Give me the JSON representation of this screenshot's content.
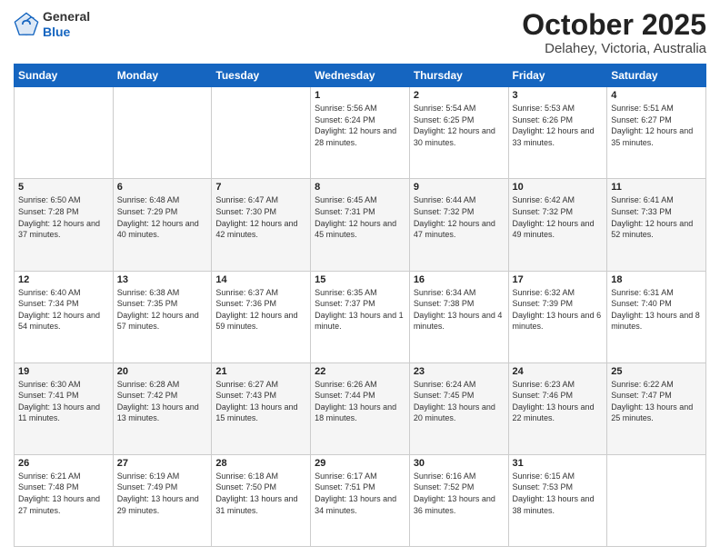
{
  "header": {
    "logo_line1": "General",
    "logo_line2": "Blue",
    "title": "October 2025",
    "subtitle": "Delahey, Victoria, Australia"
  },
  "days_of_week": [
    "Sunday",
    "Monday",
    "Tuesday",
    "Wednesday",
    "Thursday",
    "Friday",
    "Saturday"
  ],
  "weeks": [
    [
      {
        "num": "",
        "sunrise": "",
        "sunset": "",
        "daylight": ""
      },
      {
        "num": "",
        "sunrise": "",
        "sunset": "",
        "daylight": ""
      },
      {
        "num": "",
        "sunrise": "",
        "sunset": "",
        "daylight": ""
      },
      {
        "num": "1",
        "sunrise": "Sunrise: 5:56 AM",
        "sunset": "Sunset: 6:24 PM",
        "daylight": "Daylight: 12 hours and 28 minutes."
      },
      {
        "num": "2",
        "sunrise": "Sunrise: 5:54 AM",
        "sunset": "Sunset: 6:25 PM",
        "daylight": "Daylight: 12 hours and 30 minutes."
      },
      {
        "num": "3",
        "sunrise": "Sunrise: 5:53 AM",
        "sunset": "Sunset: 6:26 PM",
        "daylight": "Daylight: 12 hours and 33 minutes."
      },
      {
        "num": "4",
        "sunrise": "Sunrise: 5:51 AM",
        "sunset": "Sunset: 6:27 PM",
        "daylight": "Daylight: 12 hours and 35 minutes."
      }
    ],
    [
      {
        "num": "5",
        "sunrise": "Sunrise: 6:50 AM",
        "sunset": "Sunset: 7:28 PM",
        "daylight": "Daylight: 12 hours and 37 minutes."
      },
      {
        "num": "6",
        "sunrise": "Sunrise: 6:48 AM",
        "sunset": "Sunset: 7:29 PM",
        "daylight": "Daylight: 12 hours and 40 minutes."
      },
      {
        "num": "7",
        "sunrise": "Sunrise: 6:47 AM",
        "sunset": "Sunset: 7:30 PM",
        "daylight": "Daylight: 12 hours and 42 minutes."
      },
      {
        "num": "8",
        "sunrise": "Sunrise: 6:45 AM",
        "sunset": "Sunset: 7:31 PM",
        "daylight": "Daylight: 12 hours and 45 minutes."
      },
      {
        "num": "9",
        "sunrise": "Sunrise: 6:44 AM",
        "sunset": "Sunset: 7:32 PM",
        "daylight": "Daylight: 12 hours and 47 minutes."
      },
      {
        "num": "10",
        "sunrise": "Sunrise: 6:42 AM",
        "sunset": "Sunset: 7:32 PM",
        "daylight": "Daylight: 12 hours and 49 minutes."
      },
      {
        "num": "11",
        "sunrise": "Sunrise: 6:41 AM",
        "sunset": "Sunset: 7:33 PM",
        "daylight": "Daylight: 12 hours and 52 minutes."
      }
    ],
    [
      {
        "num": "12",
        "sunrise": "Sunrise: 6:40 AM",
        "sunset": "Sunset: 7:34 PM",
        "daylight": "Daylight: 12 hours and 54 minutes."
      },
      {
        "num": "13",
        "sunrise": "Sunrise: 6:38 AM",
        "sunset": "Sunset: 7:35 PM",
        "daylight": "Daylight: 12 hours and 57 minutes."
      },
      {
        "num": "14",
        "sunrise": "Sunrise: 6:37 AM",
        "sunset": "Sunset: 7:36 PM",
        "daylight": "Daylight: 12 hours and 59 minutes."
      },
      {
        "num": "15",
        "sunrise": "Sunrise: 6:35 AM",
        "sunset": "Sunset: 7:37 PM",
        "daylight": "Daylight: 13 hours and 1 minute."
      },
      {
        "num": "16",
        "sunrise": "Sunrise: 6:34 AM",
        "sunset": "Sunset: 7:38 PM",
        "daylight": "Daylight: 13 hours and 4 minutes."
      },
      {
        "num": "17",
        "sunrise": "Sunrise: 6:32 AM",
        "sunset": "Sunset: 7:39 PM",
        "daylight": "Daylight: 13 hours and 6 minutes."
      },
      {
        "num": "18",
        "sunrise": "Sunrise: 6:31 AM",
        "sunset": "Sunset: 7:40 PM",
        "daylight": "Daylight: 13 hours and 8 minutes."
      }
    ],
    [
      {
        "num": "19",
        "sunrise": "Sunrise: 6:30 AM",
        "sunset": "Sunset: 7:41 PM",
        "daylight": "Daylight: 13 hours and 11 minutes."
      },
      {
        "num": "20",
        "sunrise": "Sunrise: 6:28 AM",
        "sunset": "Sunset: 7:42 PM",
        "daylight": "Daylight: 13 hours and 13 minutes."
      },
      {
        "num": "21",
        "sunrise": "Sunrise: 6:27 AM",
        "sunset": "Sunset: 7:43 PM",
        "daylight": "Daylight: 13 hours and 15 minutes."
      },
      {
        "num": "22",
        "sunrise": "Sunrise: 6:26 AM",
        "sunset": "Sunset: 7:44 PM",
        "daylight": "Daylight: 13 hours and 18 minutes."
      },
      {
        "num": "23",
        "sunrise": "Sunrise: 6:24 AM",
        "sunset": "Sunset: 7:45 PM",
        "daylight": "Daylight: 13 hours and 20 minutes."
      },
      {
        "num": "24",
        "sunrise": "Sunrise: 6:23 AM",
        "sunset": "Sunset: 7:46 PM",
        "daylight": "Daylight: 13 hours and 22 minutes."
      },
      {
        "num": "25",
        "sunrise": "Sunrise: 6:22 AM",
        "sunset": "Sunset: 7:47 PM",
        "daylight": "Daylight: 13 hours and 25 minutes."
      }
    ],
    [
      {
        "num": "26",
        "sunrise": "Sunrise: 6:21 AM",
        "sunset": "Sunset: 7:48 PM",
        "daylight": "Daylight: 13 hours and 27 minutes."
      },
      {
        "num": "27",
        "sunrise": "Sunrise: 6:19 AM",
        "sunset": "Sunset: 7:49 PM",
        "daylight": "Daylight: 13 hours and 29 minutes."
      },
      {
        "num": "28",
        "sunrise": "Sunrise: 6:18 AM",
        "sunset": "Sunset: 7:50 PM",
        "daylight": "Daylight: 13 hours and 31 minutes."
      },
      {
        "num": "29",
        "sunrise": "Sunrise: 6:17 AM",
        "sunset": "Sunset: 7:51 PM",
        "daylight": "Daylight: 13 hours and 34 minutes."
      },
      {
        "num": "30",
        "sunrise": "Sunrise: 6:16 AM",
        "sunset": "Sunset: 7:52 PM",
        "daylight": "Daylight: 13 hours and 36 minutes."
      },
      {
        "num": "31",
        "sunrise": "Sunrise: 6:15 AM",
        "sunset": "Sunset: 7:53 PM",
        "daylight": "Daylight: 13 hours and 38 minutes."
      },
      {
        "num": "",
        "sunrise": "",
        "sunset": "",
        "daylight": ""
      }
    ]
  ]
}
